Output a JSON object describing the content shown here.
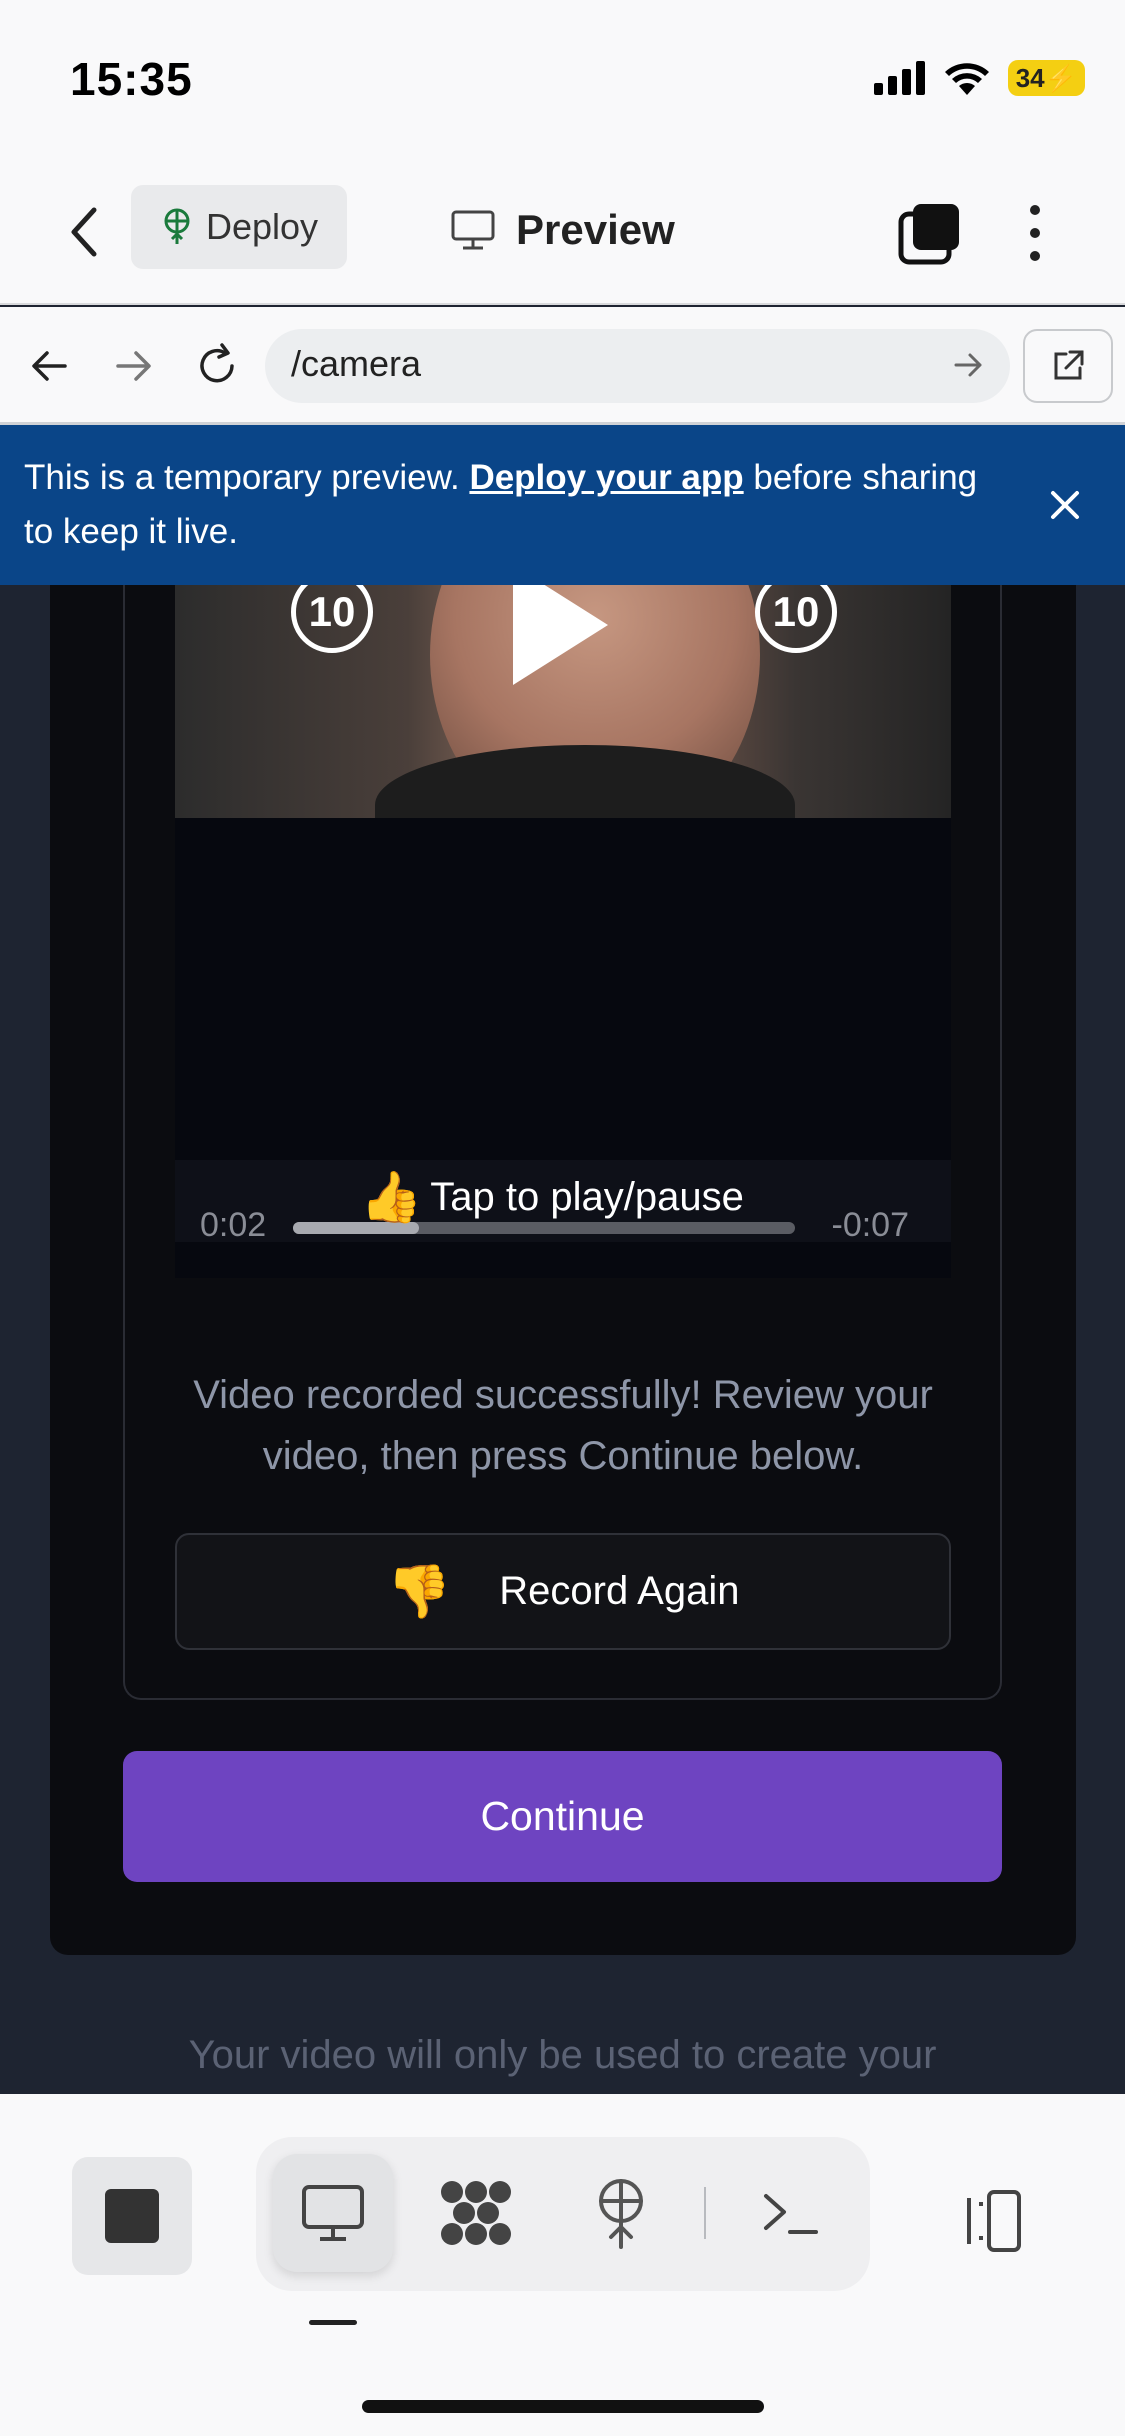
{
  "status": {
    "time": "15:35",
    "battery": "34"
  },
  "header": {
    "deploy_label": "Deploy",
    "preview_label": "Preview"
  },
  "urlbar": {
    "path": "/camera"
  },
  "banner": {
    "text_before": "This is a temporary preview. ",
    "link": "Deploy your app",
    "text_after": " before sharing to keep it live."
  },
  "video": {
    "skip_back": "10",
    "skip_forward": "10",
    "elapsed": "0:02",
    "remaining": "-0:07",
    "progress": 0.25,
    "tap_hint_emoji": "👍",
    "tap_hint": "Tap to play/pause"
  },
  "main": {
    "success_message": "Video recorded successfully! Review your video, then press Continue below.",
    "record_again_emoji": "👎",
    "record_again_label": "Record Again",
    "continue_label": "Continue",
    "privacy_note": "Your video will only be used to create your"
  },
  "colors": {
    "banner": "#0a4588",
    "continue": "#6e44c1",
    "card": "#0b0c10",
    "page": "#1e2431"
  },
  "toolbar": {
    "icons": [
      "stop-icon",
      "monitor-icon",
      "dots-grid-icon",
      "deploy-icon",
      "terminal-icon",
      "layout-icon"
    ]
  }
}
